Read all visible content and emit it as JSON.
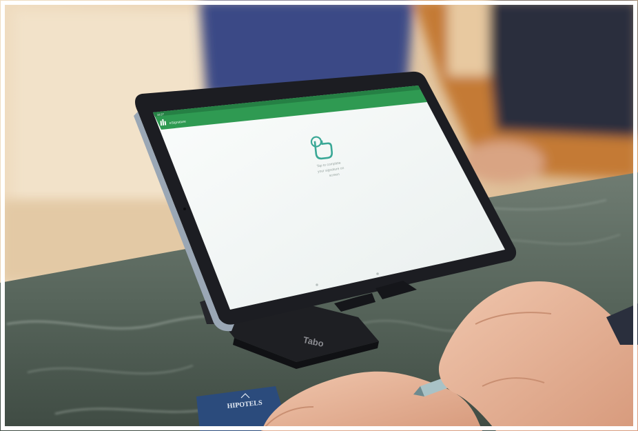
{
  "photo": {
    "colors": {
      "wall": "#e9d2b4",
      "wall_shadow": "#d8bb95",
      "marble": "#56645a",
      "marble_light": "#8e9a90",
      "tablet_frame": "#1c1d22",
      "tablet_edge": "#9aa7b5",
      "screen_bg": "#f4f8f7",
      "app_bar": "#2f9a52",
      "icon_teal": "#3aa896",
      "stand": "#1b1b1e",
      "skin": "#e6b59b",
      "stylus": "#a9c2c6",
      "card": "#2b4b7c",
      "sweater": "#c9823f",
      "shirt": "#3a4a8c"
    },
    "tablet": {
      "app_logo": "vertical-bars-logo",
      "app_name": "eSignature",
      "status_time": "10:27",
      "center_icon": "tap-hand-icon",
      "message_lines": [
        "Tap to complete",
        "your signature on",
        "screen"
      ]
    },
    "stand_brand": "Tabo",
    "card_brand": "HIPOTELS"
  }
}
